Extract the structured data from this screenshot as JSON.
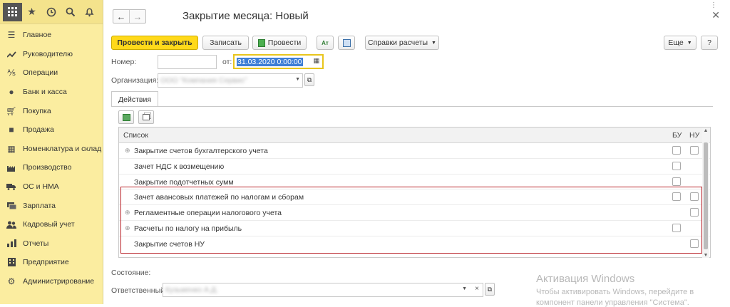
{
  "topbar_icons": [
    "apps-grid-icon",
    "star-icon",
    "history-icon",
    "search-icon",
    "bell-icon"
  ],
  "sidebar": {
    "items": [
      {
        "label": "Главное",
        "icon": "menu-lines-icon"
      },
      {
        "label": "Руководителю",
        "icon": "trend-line-icon"
      },
      {
        "label": "Операции",
        "icon": "operations-icon"
      },
      {
        "label": "Банк и касса",
        "icon": "coin-icon"
      },
      {
        "label": "Покупка",
        "icon": "cart-icon"
      },
      {
        "label": "Продажа",
        "icon": "bag-icon"
      },
      {
        "label": "Номенклатура и склад",
        "icon": "grid-icon"
      },
      {
        "label": "Производство",
        "icon": "factory-icon"
      },
      {
        "label": "ОС и НМА",
        "icon": "truck-icon"
      },
      {
        "label": "Зарплата",
        "icon": "money-icon"
      },
      {
        "label": "Кадровый учет",
        "icon": "people-icon"
      },
      {
        "label": "Отчеты",
        "icon": "report-icon"
      },
      {
        "label": "Предприятие",
        "icon": "building-icon"
      },
      {
        "label": "Администрирование",
        "icon": "gear-icon"
      }
    ]
  },
  "header": {
    "title": "Закрытие месяца: Новый"
  },
  "toolbar": {
    "post_close": "Провести и закрыть",
    "save": "Записать",
    "post": "Провести",
    "references": "Справки расчеты",
    "more": "Еще",
    "help": "?"
  },
  "form": {
    "number_label": "Номер:",
    "number_value": "",
    "date_label": "от:",
    "date_value": "31.03.2020  0:00:00",
    "org_label": "Организация:",
    "org_value": "ООО \"Компания Сервис\"",
    "tab_actions": "Действия"
  },
  "table": {
    "col_list": "Список",
    "col_bu": "БУ",
    "col_nu": "НУ",
    "rows": [
      {
        "label": "Закрытие счетов бухгалтерского учета",
        "expandable": true
      },
      {
        "label": "Зачет НДС к возмещению",
        "expandable": false
      },
      {
        "label": "Закрытие подотчетных сумм",
        "expandable": false
      },
      {
        "label": "Зачет авансовых платежей по налогам и сборам",
        "expandable": false
      },
      {
        "label": "Регламентные операции налогового учета",
        "expandable": true
      },
      {
        "label": "Расчеты по налогу на прибыль",
        "expandable": true
      },
      {
        "label": "Закрытие счетов НУ",
        "expandable": false
      }
    ]
  },
  "footer": {
    "state_label": "Состояние:",
    "responsible_label": "Ответственный",
    "responsible_value": "Кузьменко А.Д."
  },
  "activation": {
    "line1": "Активация Windows",
    "line2": "Чтобы активировать Windows, перейдите в",
    "line3": "компонент панели управления \"Система\"."
  }
}
